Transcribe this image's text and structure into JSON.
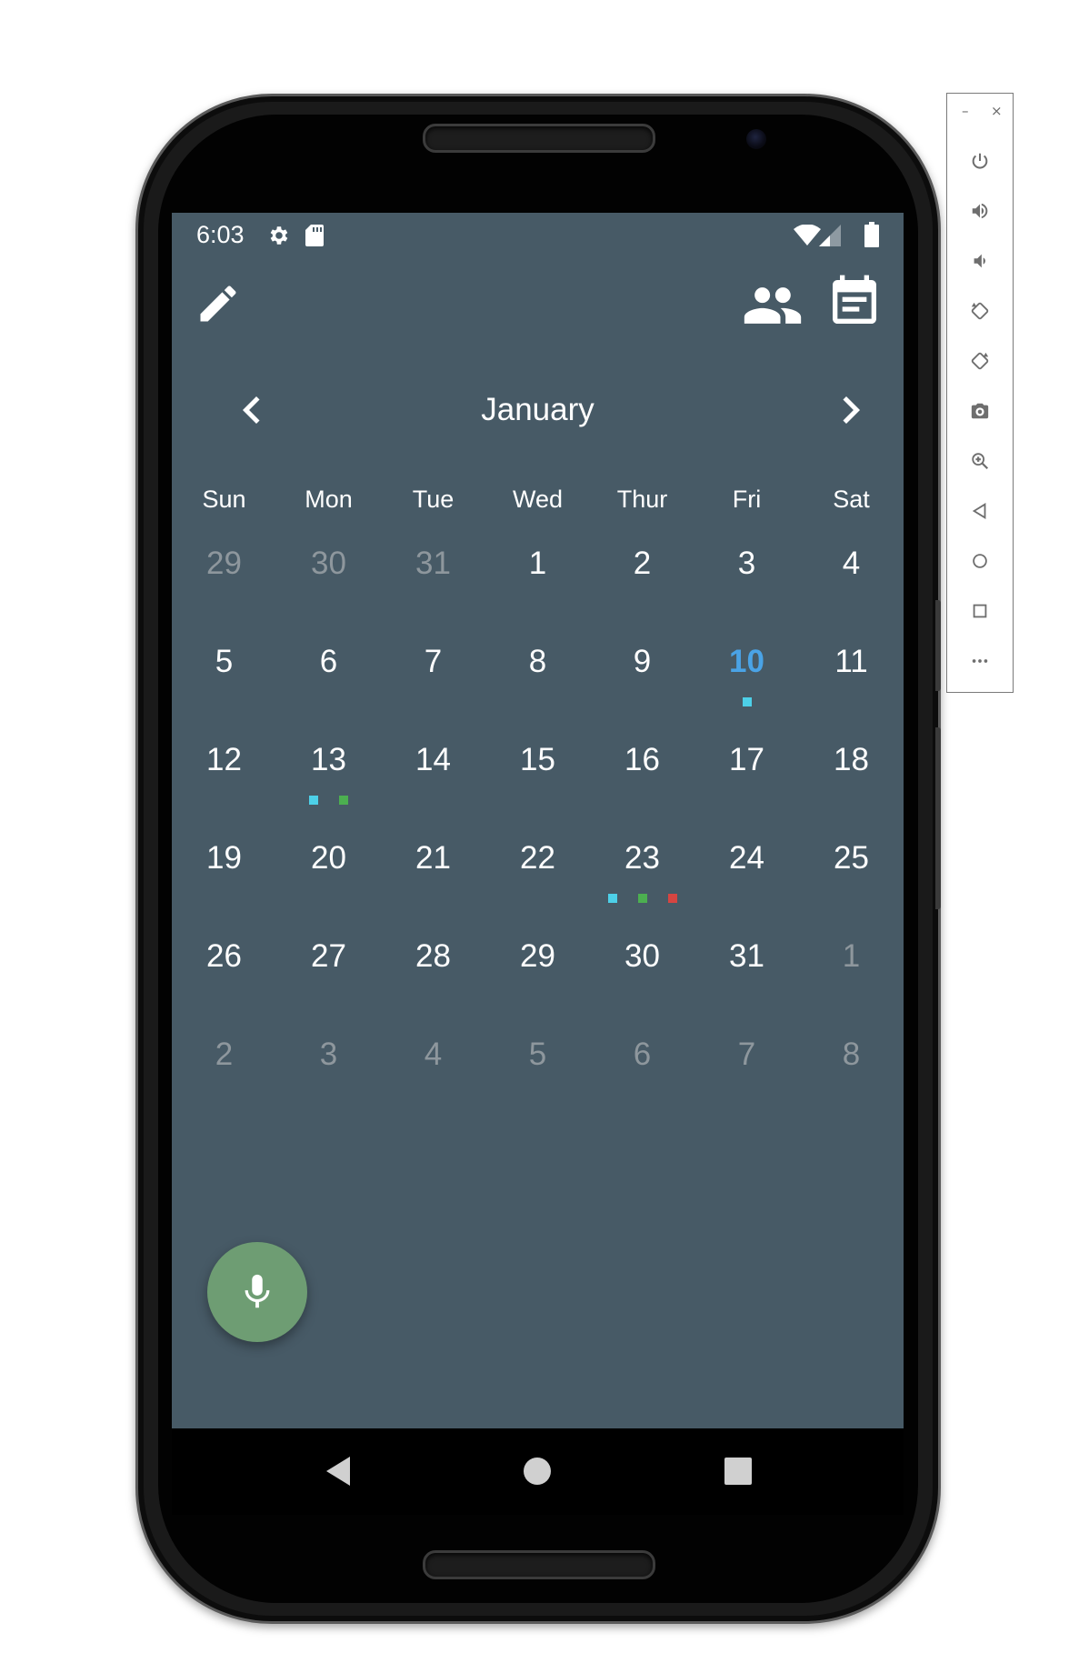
{
  "status_bar": {
    "time": "6:03",
    "left_icons": [
      "settings-icon",
      "sd-card-icon"
    ],
    "right_icons": [
      "wifi-icon",
      "cellular-signal-icon",
      "battery-icon"
    ]
  },
  "app_bar": {
    "left_icon": "edit-pencil-icon",
    "right_icons": [
      "people-icon",
      "event-note-icon"
    ]
  },
  "calendar": {
    "month": "January",
    "weekdays": [
      "Sun",
      "Mon",
      "Tue",
      "Wed",
      "Thur",
      "Fri",
      "Sat"
    ],
    "weeks": [
      [
        {
          "d": "29",
          "o": 1
        },
        {
          "d": "30",
          "o": 1
        },
        {
          "d": "31",
          "o": 1
        },
        {
          "d": "1"
        },
        {
          "d": "2"
        },
        {
          "d": "3"
        },
        {
          "d": "4"
        }
      ],
      [
        {
          "d": "5"
        },
        {
          "d": "6"
        },
        {
          "d": "7"
        },
        {
          "d": "8"
        },
        {
          "d": "9"
        },
        {
          "d": "10",
          "today": 1,
          "dots": [
            "#4dd0e8"
          ]
        },
        {
          "d": "11"
        }
      ],
      [
        {
          "d": "12"
        },
        {
          "d": "13",
          "dots": [
            "#4dd0e8",
            "#4caf50"
          ]
        },
        {
          "d": "14"
        },
        {
          "d": "15"
        },
        {
          "d": "16"
        },
        {
          "d": "17"
        },
        {
          "d": "18"
        }
      ],
      [
        {
          "d": "19"
        },
        {
          "d": "20"
        },
        {
          "d": "21"
        },
        {
          "d": "22"
        },
        {
          "d": "23",
          "dots": [
            "#4dd0e8",
            "#4caf50",
            "#d64541"
          ]
        },
        {
          "d": "24"
        },
        {
          "d": "25"
        }
      ],
      [
        {
          "d": "26"
        },
        {
          "d": "27"
        },
        {
          "d": "28"
        },
        {
          "d": "29"
        },
        {
          "d": "30"
        },
        {
          "d": "31"
        },
        {
          "d": "1",
          "o": 1
        }
      ],
      [
        {
          "d": "2",
          "o": 1
        },
        {
          "d": "3",
          "o": 1
        },
        {
          "d": "4",
          "o": 1
        },
        {
          "d": "5",
          "o": 1
        },
        {
          "d": "6",
          "o": 1
        },
        {
          "d": "7",
          "o": 1
        },
        {
          "d": "8",
          "o": 1
        }
      ]
    ]
  },
  "fab": {
    "icon": "microphone-icon"
  },
  "nav_bar": {
    "buttons": [
      "back-icon",
      "home-icon",
      "recents-icon"
    ]
  },
  "emulator_toolbar": {
    "window_controls": [
      "–",
      "×"
    ],
    "tools": [
      "power-icon",
      "volume-up-icon",
      "volume-down-icon",
      "rotate-left-icon",
      "rotate-right-icon",
      "camera-icon",
      "zoom-icon",
      "back-icon",
      "home-icon",
      "overview-icon",
      "more-icon"
    ]
  },
  "colors": {
    "screen_bg": "#475a66",
    "today": "#4aa3e6",
    "fab": "#6e9d73",
    "event_cyan": "#4dd0e8",
    "event_green": "#4caf50",
    "event_red": "#d64541"
  }
}
